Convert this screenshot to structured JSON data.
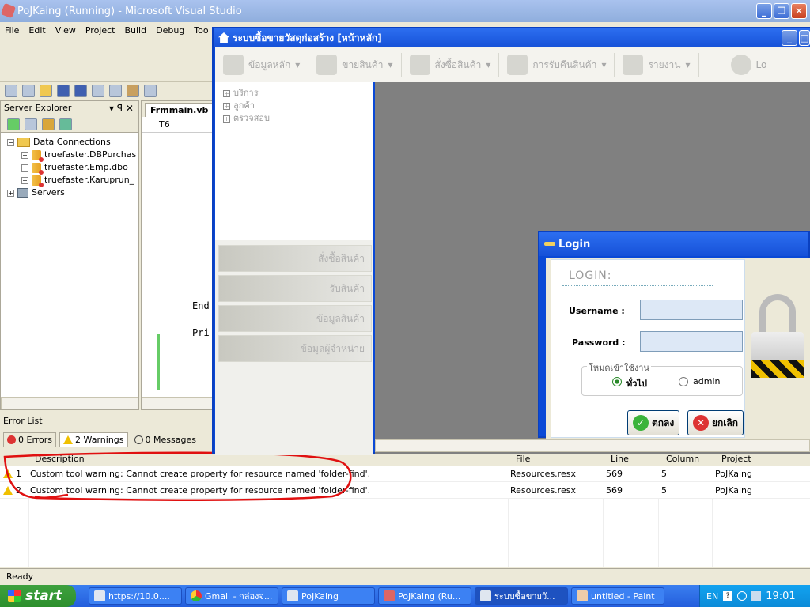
{
  "vs": {
    "title": "PoJKaing (Running) - Microsoft Visual Studio",
    "menu": [
      "File",
      "Edit",
      "View",
      "Project",
      "Build",
      "Debug",
      "Too"
    ],
    "status": "Ready"
  },
  "server_explorer": {
    "title": "Server Explorer",
    "pin": "▾ ꟼ ✕",
    "tree": {
      "data_connections": "Data Connections",
      "items": [
        "truefaster.DBPurchas",
        "truefaster.Emp.dbo",
        "truefaster.Karuprun_"
      ],
      "servers": "Servers"
    }
  },
  "editor": {
    "tab": "Frmmain.vb",
    "combo": "T6",
    "code_end": "End",
    "code_pri": "Pri"
  },
  "error_list": {
    "title": "Error List",
    "errors_btn": "0 Errors",
    "warnings_btn": "2 Warnings",
    "messages_btn": "0 Messages",
    "columns": [
      "Description",
      "File",
      "Line",
      "Column",
      "Project"
    ],
    "rows": [
      {
        "num": "1",
        "desc": "Custom tool warning: Cannot create property for resource named 'folder-find'.",
        "file": "Resources.resx",
        "line": "569",
        "col": "5",
        "project": "PoJKaing"
      },
      {
        "num": "2",
        "desc": "Custom tool warning: Cannot create property for resource named 'folder-find'.",
        "file": "Resources.resx",
        "line": "569",
        "col": "5",
        "project": "PoJKaing"
      }
    ]
  },
  "app": {
    "title": "ระบบซื้อขายวัสดุก่อสร้าง [หน้าหลัก]",
    "toolbar": [
      "ข้อมูลหลัก",
      "ขายสินค้า",
      "สั่งซื้อสินค้า",
      "การรับคืนสินค้า",
      "รายงาน",
      "Lo"
    ],
    "tree": [
      "บริการ",
      "ลูกค้า",
      "ตรวจสอบ"
    ],
    "nav": [
      "สั่งซื้อสินค้า",
      "รับสินค้า",
      "ข้อมูลสินค้า",
      "ข้อมูลผู้จำหน่าย"
    ]
  },
  "login": {
    "title": "Login",
    "heading": "LOGIN:",
    "username_label": "Username :",
    "password_label": "Password :",
    "mode_legend": "โหมดเข้าใช้งาน",
    "mode_general": "ทั่วไป",
    "mode_admin": "admin",
    "ok": "ตกลง",
    "cancel": "ยกเลิก"
  },
  "taskbar": {
    "start": "start",
    "tasks": [
      "https://10.0....",
      "Gmail - กล่องจ...",
      "PoJKaing",
      "PoJKaing (Ru...",
      "ระบบซื้อขายวั...",
      "untitled - Paint"
    ],
    "lang": "EN",
    "time": "19:01"
  },
  "colors": {
    "xp_blue": "#0a49d6",
    "annotation_red": "#e01010",
    "start_green": "#3ea13e"
  }
}
